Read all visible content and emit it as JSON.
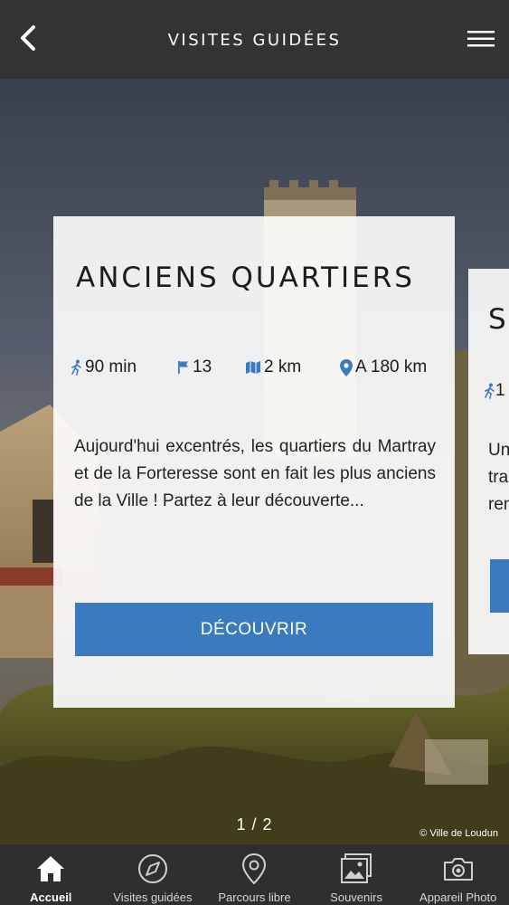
{
  "header": {
    "title": "VISITES GUIDÉES",
    "back_icon": "chevron-left-icon",
    "menu_icon": "hamburger-menu-icon"
  },
  "cards": [
    {
      "title": "ANCIENS QUARTIERS",
      "duration": "90 min",
      "steps": "13",
      "distance": "2 km",
      "location": "A 180 km",
      "description": "Aujourd'hui excentrés, les quartiers du Martray et de la Forteresse sont en fait les plus anciens de la Ville ! Partez à leur découverte...",
      "cta_label": "DÉCOUVRIR"
    },
    {
      "title": "S",
      "duration": "1",
      "description_lines": [
        "Un",
        "tra",
        "ren"
      ]
    }
  ],
  "pager": "1 / 2",
  "photo_credit": "© Ville de Loudun",
  "tabs": [
    {
      "label": "Accueil",
      "icon": "home-icon",
      "active": true
    },
    {
      "label": "Visites guidées",
      "icon": "compass-icon",
      "active": false
    },
    {
      "label": "Parcours libre",
      "icon": "map-pin-icon",
      "active": false
    },
    {
      "label": "Souvenirs",
      "icon": "photo-gallery-icon",
      "active": false
    },
    {
      "label": "Appareil Photo",
      "icon": "camera-icon",
      "active": false
    }
  ],
  "colors": {
    "topbar": "#333333",
    "accent": "#3a7bbf",
    "tabbar": "#2f2f2f"
  }
}
